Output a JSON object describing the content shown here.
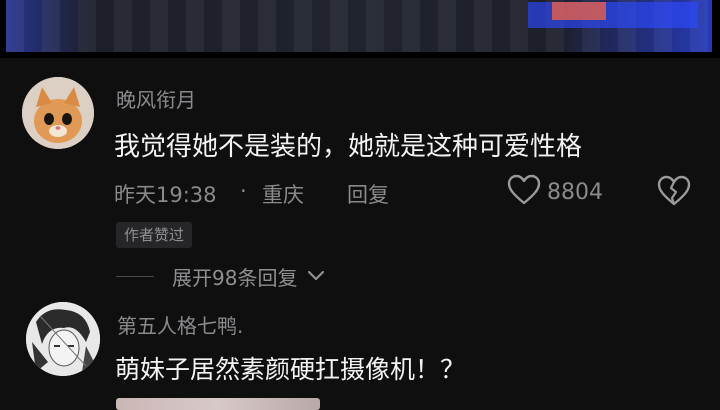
{
  "comments": [
    {
      "username": "晚风衔月",
      "content": "我觉得她不是装的，她就是这种可爱性格",
      "time": "昨天19:38",
      "separator": "·",
      "location": "重庆",
      "reply_label": "回复",
      "likes": "8804",
      "author_badge": "作者赞过",
      "expand_label": "展开98条回复"
    },
    {
      "username": "第五人格七鸭.",
      "content": "萌妹子居然素颜硬扛摄像机！？"
    }
  ],
  "icons": {
    "like": "heart-outline-icon",
    "dislike": "broken-heart-icon",
    "expand": "chevron-down-icon"
  }
}
